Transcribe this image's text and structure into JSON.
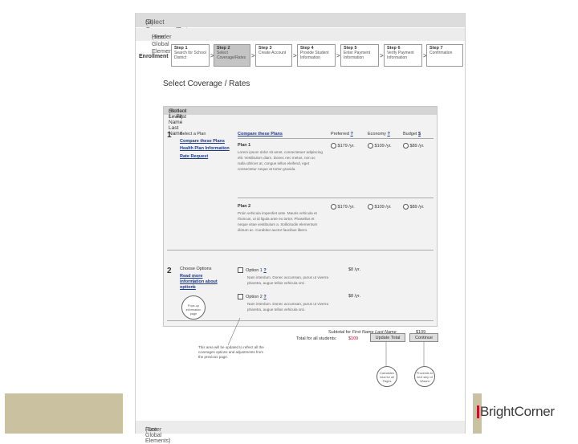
{
  "sheet": {
    "title": "Select Coverage/Rates",
    "title_suffix": "(3)",
    "header_label": "Header",
    "header_note": "(See Global Elements)",
    "footer_label": "Footer",
    "footer_note": "(See Global Elements)"
  },
  "stepbar": {
    "label": "Enrollment",
    "steps": [
      {
        "num": "Step 1",
        "text": "Search for School District"
      },
      {
        "num": "Step 2",
        "text": "Select Coverage/Rates"
      },
      {
        "num": "Step 3",
        "text": "Create Account"
      },
      {
        "num": "Step 4",
        "text": "Provide Student Information"
      },
      {
        "num": "Step 5",
        "text": "Enter Payment Information"
      },
      {
        "num": "Step 6",
        "text": "Verify Payment Information"
      },
      {
        "num": "Step 7",
        "text": "Confirmation"
      }
    ],
    "arrow": ">"
  },
  "main": {
    "page_title": "Select Coverage / Rates",
    "student_header": "Student 1 - First Name Last Name",
    "student_header_level": "(School Level)",
    "section1": {
      "number": "1",
      "label": "Select a Plan",
      "links": [
        "Compare these Plans",
        "Health Plan Information",
        "Rate Request"
      ],
      "compare_link": "Compare these Plans",
      "columns": [
        {
          "name": "Preferred",
          "help": "?"
        },
        {
          "name": "Economy",
          "help": "?"
        },
        {
          "name": "Budget",
          "help": "$"
        }
      ],
      "plans": [
        {
          "name": "Plan 1",
          "description": "Lorem ipsum dolor sit amet, consectetuer adipiscing elit. Vestibulum diam. Donec nec metus, non ac nulla ultrices at, congue tellus eleifend, eget consectetur neque at tortor gravida.",
          "prices": [
            "$179 /yr.",
            "$109 /yr.",
            "$89 /yr."
          ]
        },
        {
          "name": "Plan 2",
          "description": "Proin vehicula imperdiet ante. Mauris vehicula et rhoncus, ut id ligula ante eu tortor. Phasellus et neque vitae vestibulum a. Sollicitudin elementum dictum ac. Curabitur auctor faucibus libero.",
          "prices": [
            "$179 /yr.",
            "$109 /yr.",
            "$89 /yr."
          ]
        }
      ]
    },
    "section2": {
      "number": "2",
      "label": "Choose Options",
      "links": [
        "Read more information",
        "about options"
      ],
      "options": [
        {
          "name": "Option 1",
          "help": "?",
          "price": "$8 /yr.",
          "description": "Nam interdum. Donec accumsan, purus ut viverra pharetra, augue tellus vehicula orci."
        },
        {
          "name": "Option 2",
          "help": "?",
          "price": "$8 /yr.",
          "description": "Nam interdum. Donec accumsan, purus ut viverra pharetra, augue tellus vehicula orci."
        }
      ],
      "subtotal_label": "Subtotal for",
      "subtotal_name": "First Name Last Name",
      "subtotal_value": "$109"
    },
    "total_label": "Total for all students:",
    "total_value": "$109",
    "update_button": "Update Total",
    "continue_button": "Continue"
  },
  "annotations": {
    "info_circle": "Pops-up information page",
    "note": "This area will be updated to reflect all the coverages options and adjustments from the previous page.",
    "update_circle": "Calculates total for all Pages",
    "continue_circle": "Proceeds to next step of Wizard"
  },
  "brand": {
    "name": "BrightCorner",
    "mark_color": "#c8102e",
    "accent_tan": "#c9c1a0"
  }
}
